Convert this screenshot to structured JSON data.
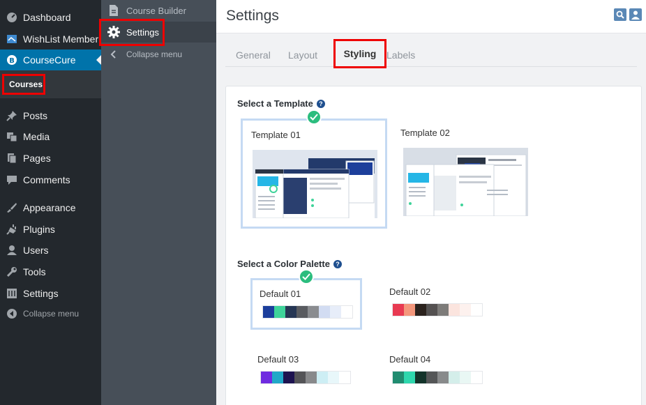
{
  "wp_menu": {
    "items": [
      {
        "label": "Dashboard",
        "icon": "dashboard-icon"
      },
      {
        "label": "WishList Member",
        "icon": "wishlist-icon"
      },
      {
        "label": "CourseCure",
        "icon": "coursecure-icon"
      },
      {
        "label": "Posts",
        "icon": "pin-icon"
      },
      {
        "label": "Media",
        "icon": "media-icon"
      },
      {
        "label": "Pages",
        "icon": "pages-icon"
      },
      {
        "label": "Comments",
        "icon": "comments-icon"
      },
      {
        "label": "Appearance",
        "icon": "appearance-icon"
      },
      {
        "label": "Plugins",
        "icon": "plugins-icon"
      },
      {
        "label": "Users",
        "icon": "users-icon"
      },
      {
        "label": "Tools",
        "icon": "tools-icon"
      },
      {
        "label": "Settings",
        "icon": "settings-icon"
      },
      {
        "label": "Collapse menu",
        "icon": "collapse-icon"
      }
    ],
    "submenu_courses": "Courses"
  },
  "cc_menu": {
    "course_builder": "Course Builder",
    "settings": "Settings",
    "collapse": "Collapse menu"
  },
  "header": {
    "title": "Settings"
  },
  "tabs": [
    "General",
    "Layout",
    "Styling",
    "Labels"
  ],
  "active_tab": "Styling",
  "template_section": {
    "title": "Select a Template",
    "templates": [
      "Template 01",
      "Template 02"
    ],
    "selected": "Template 01"
  },
  "palette_section": {
    "title": "Select a Color Palette",
    "selected": "Default 01",
    "palettes": [
      {
        "name": "Default 01",
        "colors": [
          "#1c3e9c",
          "#3fd39a",
          "#263654",
          "#595b60",
          "#8a8c90",
          "#d2dcf2",
          "#e7edf9",
          "#ffffff"
        ]
      },
      {
        "name": "Default 02",
        "colors": [
          "#e83a52",
          "#f4977c",
          "#2b221d",
          "#545151",
          "#7d7b79",
          "#fbe4de",
          "#fdf1ee",
          "#ffffff"
        ]
      },
      {
        "name": "Default 03",
        "colors": [
          "#6f2be0",
          "#21a8c8",
          "#1d1350",
          "#545457",
          "#88898b",
          "#cdeef4",
          "#e8f7fa",
          "#ffffff"
        ]
      },
      {
        "name": "Default 04",
        "colors": [
          "#208c70",
          "#2ed7ad",
          "#13332a",
          "#545657",
          "#888a8b",
          "#d4eeea",
          "#e9f7f4",
          "#ffffff"
        ]
      }
    ]
  },
  "colors": {
    "wp_active": "#0073aa",
    "highlight_border": "#ee0000",
    "check": "#2bbd7e",
    "selection": "#c5daf3"
  }
}
